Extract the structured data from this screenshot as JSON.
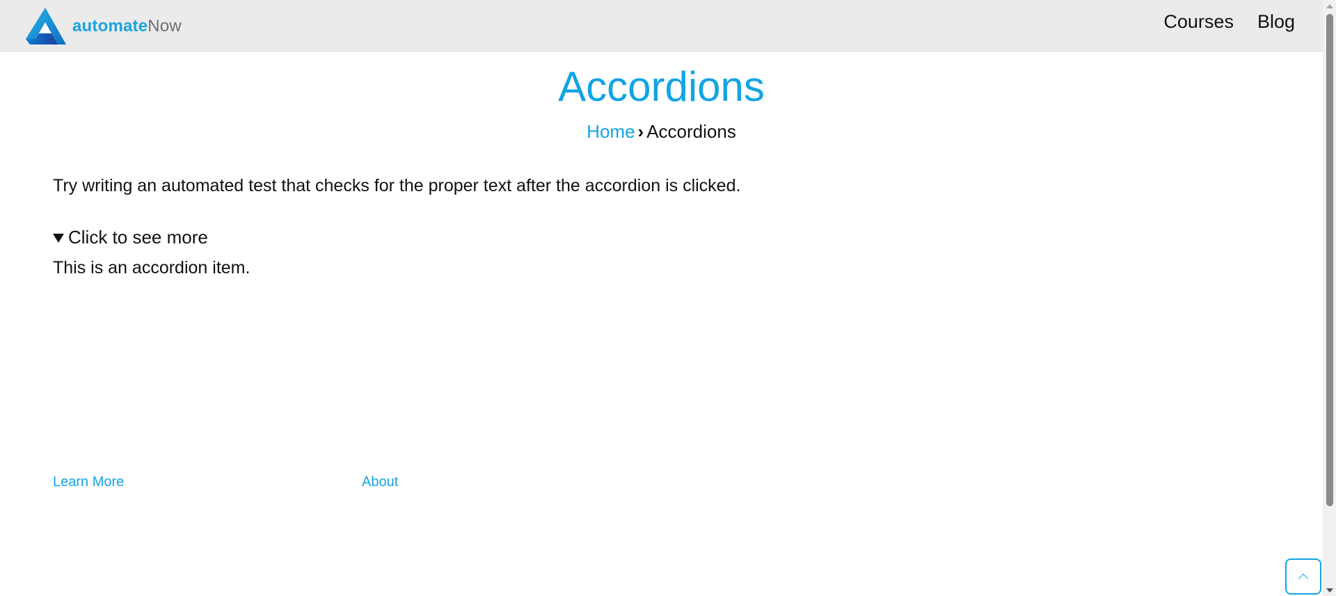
{
  "header": {
    "logo": {
      "text_bold": "automate",
      "text_light": "Now",
      "icon": "automatenow-logo-icon"
    },
    "nav": [
      {
        "label": "Courses"
      },
      {
        "label": "Blog"
      }
    ]
  },
  "page": {
    "title": "Accordions",
    "breadcrumb": {
      "home": "Home",
      "separator": "›",
      "current": "Accordions"
    },
    "intro": "Try writing an automated test that checks for the proper text after the accordion is clicked.",
    "accordion": {
      "summary": "Click to see more",
      "content": "This is an accordion item.",
      "expanded": true
    }
  },
  "footer": {
    "links": [
      {
        "label": "Learn More"
      },
      {
        "label": "About"
      }
    ]
  },
  "back_to_top": {
    "icon": "chevron-up-icon"
  },
  "colors": {
    "accent": "#12a4e4",
    "header_bg": "#ebebeb",
    "text": "#111111"
  }
}
